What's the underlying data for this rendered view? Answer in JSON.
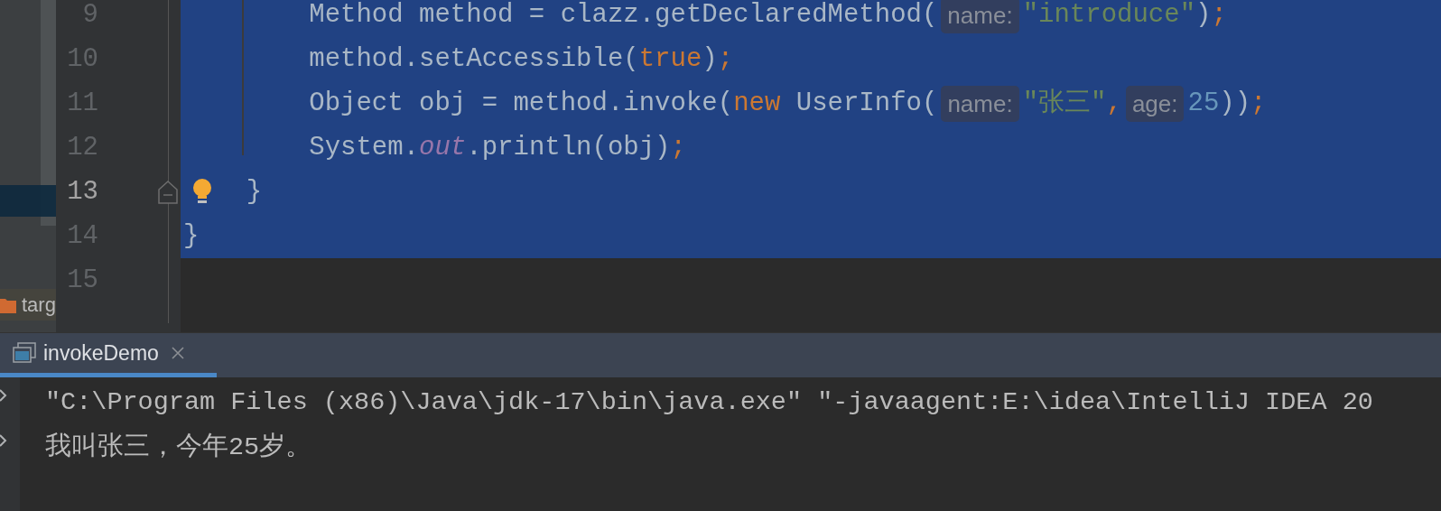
{
  "sidebar": {
    "items": [
      {
        "selected": true
      },
      {
        "kind": "folder",
        "label": "targ",
        "selected": false
      }
    ]
  },
  "editor": {
    "lines": [
      {
        "number": "9",
        "selected": true,
        "current": false,
        "tokens": [
          {
            "kind": "plain",
            "text": "        Method method = clazz.getDeclaredMethod("
          },
          {
            "kind": "hint",
            "text": "name:"
          },
          {
            "kind": "string",
            "text": "\"introduce\""
          },
          {
            "kind": "plain",
            "text": ")"
          },
          {
            "kind": "keyword",
            "text": ";"
          }
        ]
      },
      {
        "number": "10",
        "selected": true,
        "current": false,
        "tokens": [
          {
            "kind": "plain",
            "text": "        method.setAccessible("
          },
          {
            "kind": "keyword",
            "text": "true"
          },
          {
            "kind": "plain",
            "text": ")"
          },
          {
            "kind": "keyword",
            "text": ";"
          }
        ]
      },
      {
        "number": "11",
        "selected": true,
        "current": false,
        "tokens": [
          {
            "kind": "plain",
            "text": "        Object obj = method.invoke("
          },
          {
            "kind": "keyword",
            "text": "new"
          },
          {
            "kind": "plain",
            "text": " UserInfo("
          },
          {
            "kind": "hint",
            "text": "name:"
          },
          {
            "kind": "string",
            "text": "\"张三\""
          },
          {
            "kind": "keyword",
            "text": ","
          },
          {
            "kind": "hint",
            "text": "age:"
          },
          {
            "kind": "number",
            "text": "25"
          },
          {
            "kind": "plain",
            "text": "))"
          },
          {
            "kind": "keyword",
            "text": ";"
          }
        ]
      },
      {
        "number": "12",
        "selected": true,
        "current": false,
        "tokens": [
          {
            "kind": "plain",
            "text": "        System."
          },
          {
            "kind": "static",
            "text": "out"
          },
          {
            "kind": "plain",
            "text": ".println(obj)"
          },
          {
            "kind": "keyword",
            "text": ";"
          }
        ]
      },
      {
        "number": "13",
        "selected": true,
        "current": true,
        "foldable": true,
        "intention": true,
        "tokens": [
          {
            "kind": "plain",
            "text": "    }"
          }
        ]
      },
      {
        "number": "14",
        "selected": true,
        "current": false,
        "tokens": [
          {
            "kind": "plain",
            "text": "}"
          }
        ]
      },
      {
        "number": "15",
        "selected": false,
        "current": false
      }
    ]
  },
  "run_panel": {
    "tabs": [
      {
        "label": "invokeDemo",
        "selected": true,
        "closable": true
      }
    ],
    "console": [
      "\"C:\\Program Files (x86)\\Java\\jdk-17\\bin\\java.exe\" \"-javaagent:E:\\idea\\IntelliJ IDEA 20",
      "我叫张三，今年25岁。"
    ]
  }
}
